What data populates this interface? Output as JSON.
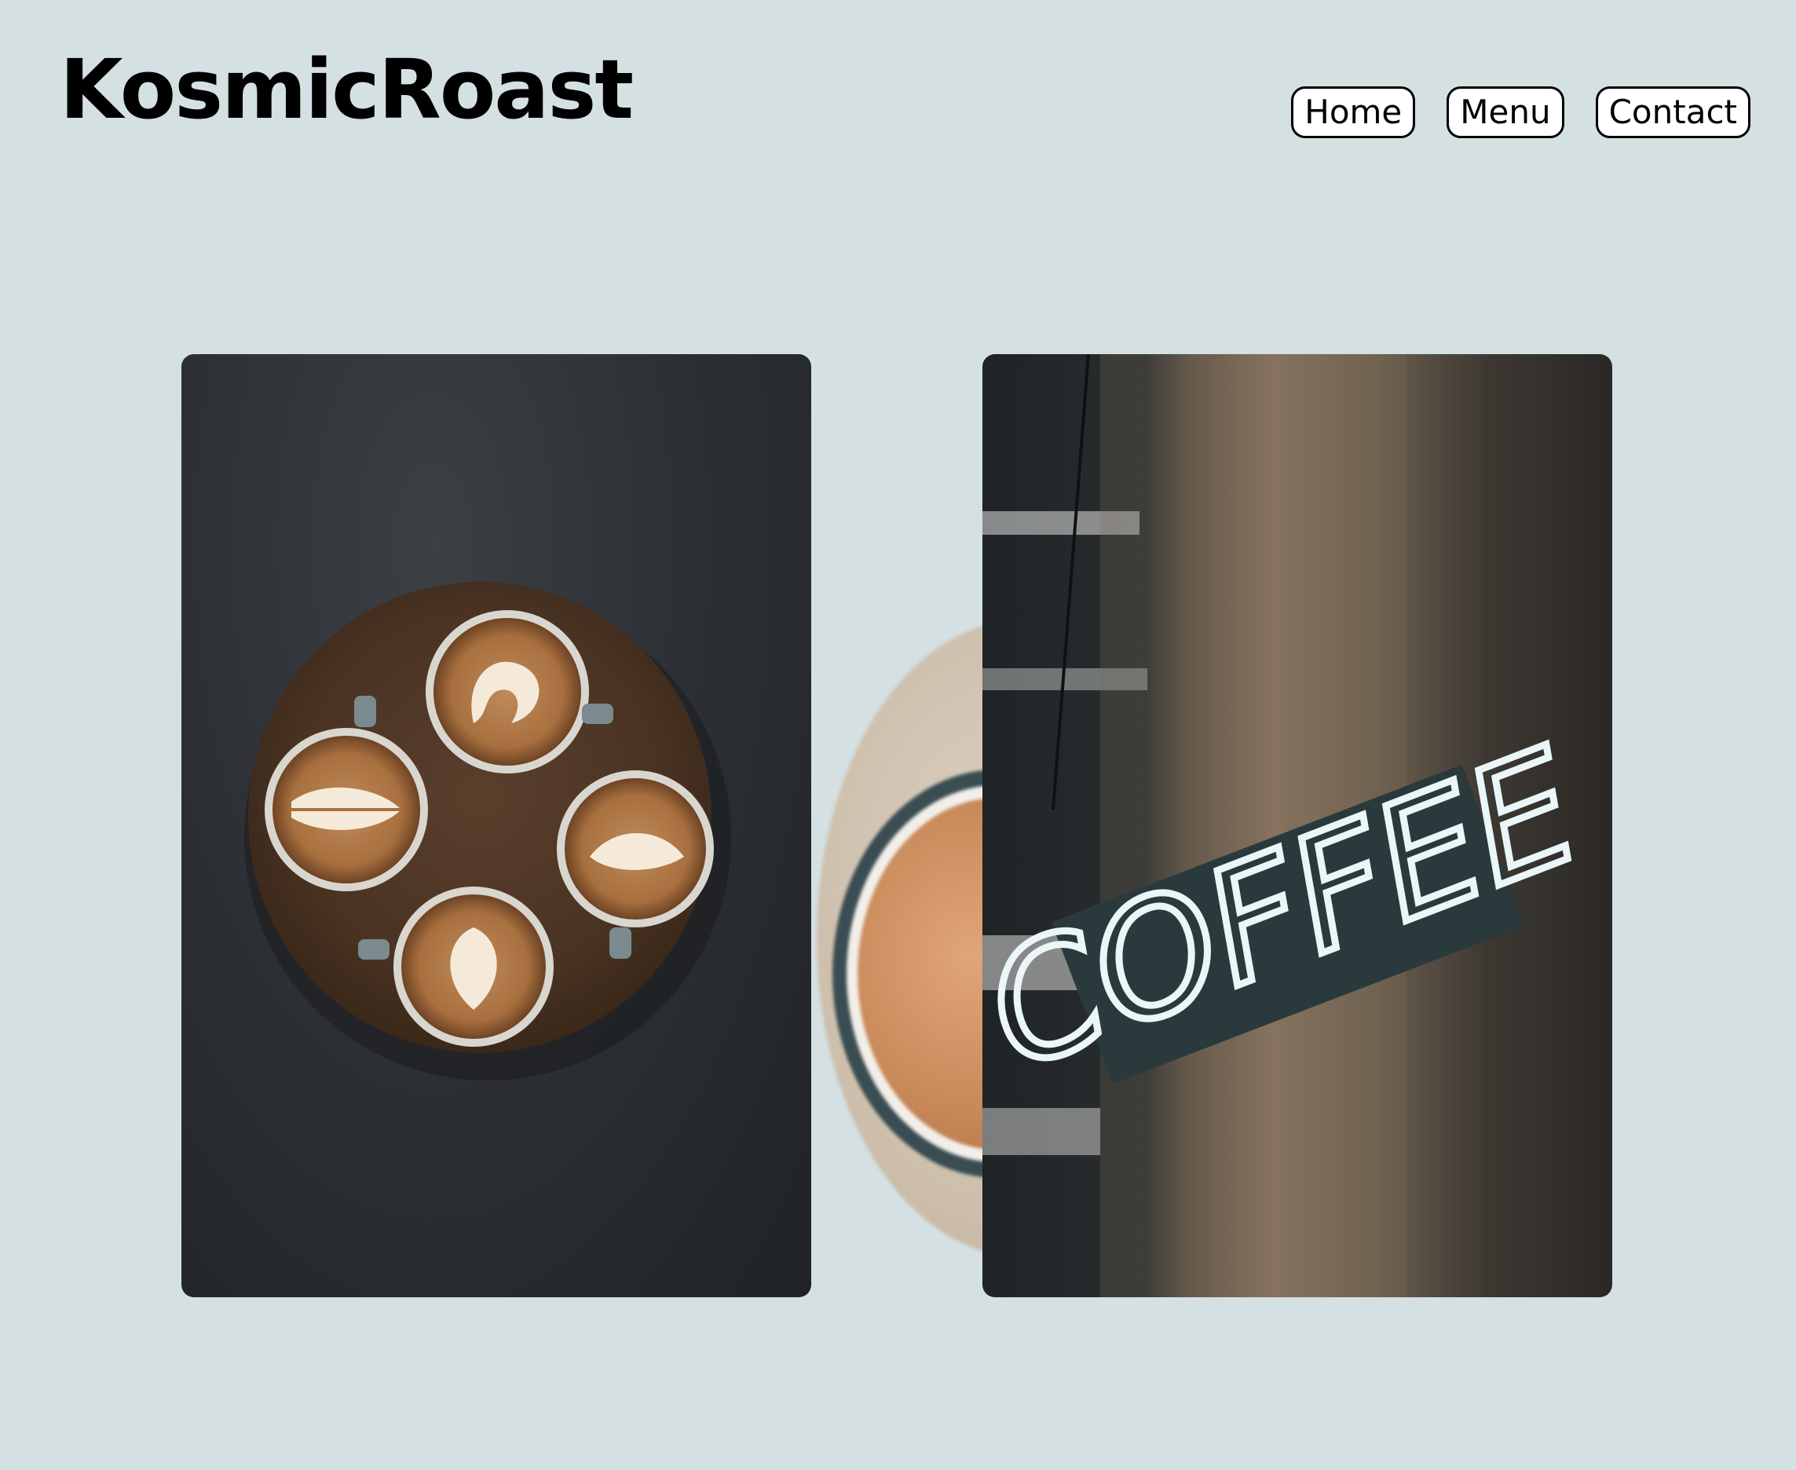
{
  "brand": {
    "name": "KosmicRoast"
  },
  "nav": {
    "items": [
      {
        "label": "Home"
      },
      {
        "label": "Menu"
      },
      {
        "label": "Contact"
      }
    ]
  },
  "gallery": {
    "photos": [
      {
        "subject": "Four latte art cups on a round wooden table"
      },
      {
        "subject": "Neon coffee sign on a concrete pillar",
        "sign_text": "COFFEE"
      }
    ]
  },
  "colors": {
    "background": "#d4e0e2",
    "text": "#000000",
    "button_bg": "#ffffff"
  }
}
